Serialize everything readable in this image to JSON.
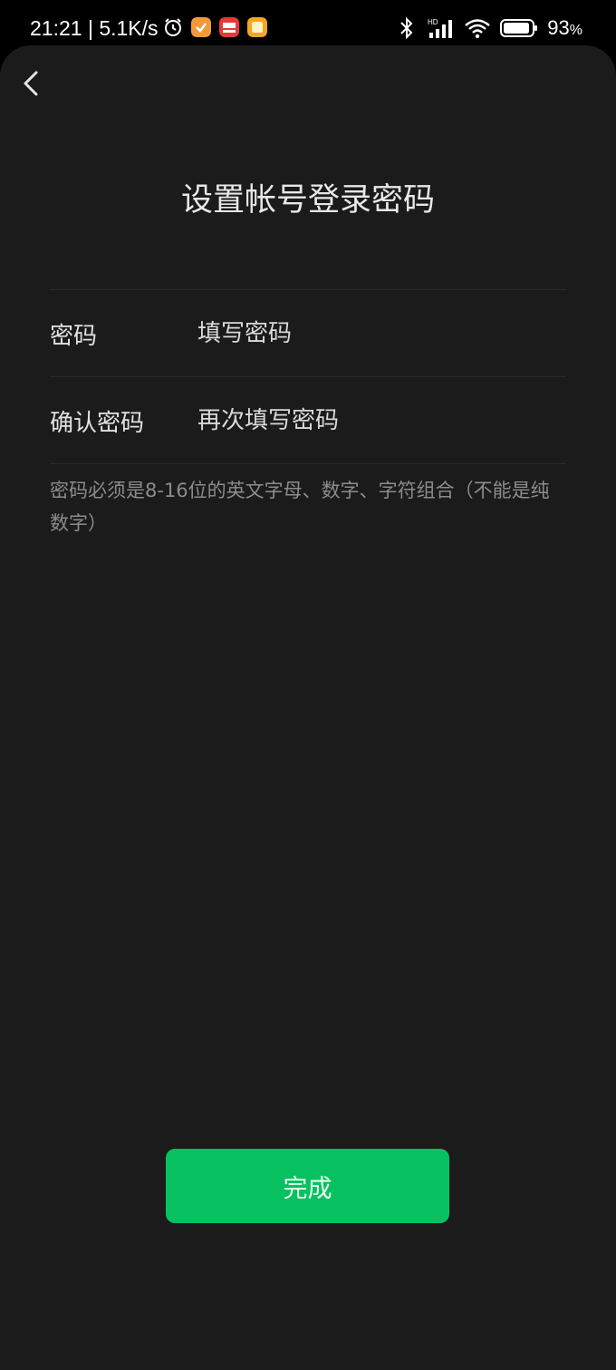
{
  "status_bar": {
    "time": "21:21",
    "net_speed": "5.1K/s",
    "battery_percent": "93",
    "battery_unit": "%",
    "icons": [
      "alarm-icon",
      "app-icon-orange",
      "app-icon-red",
      "app-icon-yellow",
      "bluetooth-icon",
      "hd-signal-icon",
      "wifi-icon",
      "battery-icon"
    ]
  },
  "header": {
    "back_icon": "chevron-left-icon",
    "title": "设置帐号登录密码"
  },
  "form": {
    "password": {
      "label": "密码",
      "placeholder": "填写密码",
      "value": ""
    },
    "confirm": {
      "label": "确认密码",
      "placeholder": "再次填写密码",
      "value": ""
    },
    "hint": "密码必须是8-16位的英文字母、数字、字符组合（不能是纯数字）"
  },
  "actions": {
    "done_label": "完成"
  },
  "colors": {
    "accent": "#07c160",
    "background": "#1b1b1b"
  }
}
